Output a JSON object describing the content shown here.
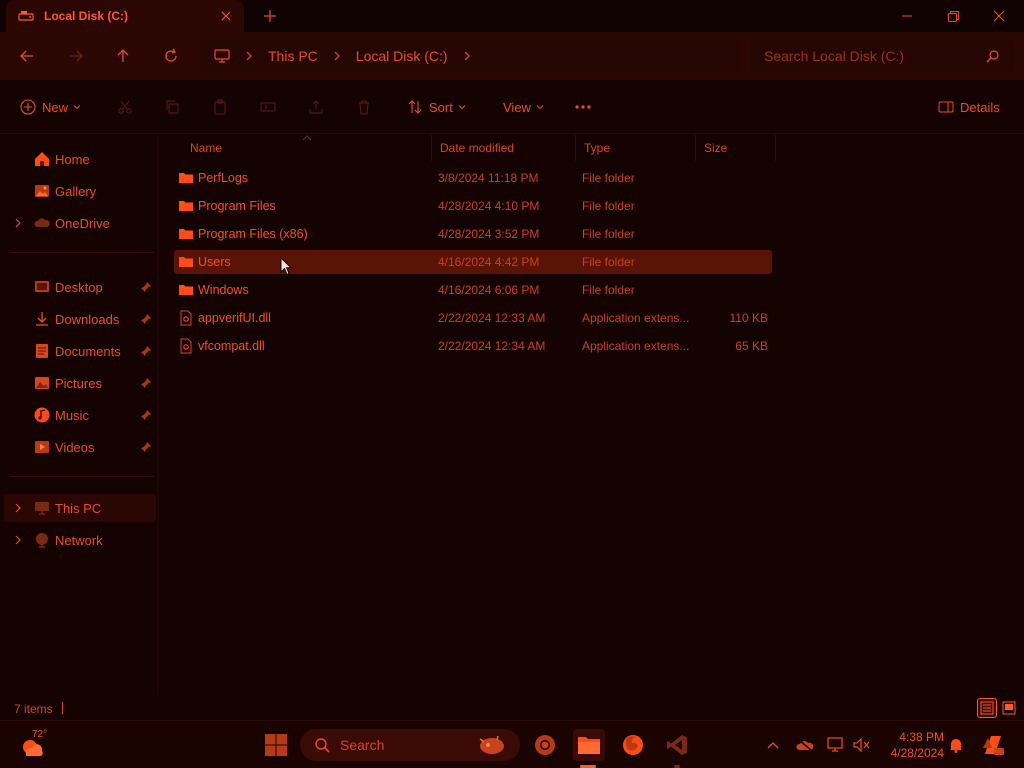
{
  "colors": {
    "accent": "#ff5a24",
    "folder": "#ff4b14",
    "background": "#140300",
    "selection": "#5a1405"
  },
  "window": {
    "tab_title": "Local Disk (C:)",
    "tab_icon": "drive-icon"
  },
  "address": {
    "breadcrumbs": [
      "This PC",
      "Local Disk (C:)"
    ],
    "search_placeholder": "Search Local Disk (C:)"
  },
  "toolbar": {
    "new_label": "New",
    "sort_label": "Sort",
    "view_label": "View",
    "details_label": "Details"
  },
  "sidebar": {
    "items": [
      {
        "label": "Home",
        "icon": "home-icon"
      },
      {
        "label": "Gallery",
        "icon": "gallery-icon"
      },
      {
        "label": "OneDrive",
        "icon": "cloud-icon"
      },
      {
        "label": "Desktop",
        "icon": "desktop-folder-icon",
        "pinned": true
      },
      {
        "label": "Downloads",
        "icon": "download-icon",
        "pinned": true
      },
      {
        "label": "Documents",
        "icon": "documents-icon",
        "pinned": true
      },
      {
        "label": "Pictures",
        "icon": "pictures-icon",
        "pinned": true
      },
      {
        "label": "Music",
        "icon": "music-icon",
        "pinned": true
      },
      {
        "label": "Videos",
        "icon": "videos-icon",
        "pinned": true
      },
      {
        "label": "This PC",
        "icon": "computer-icon"
      },
      {
        "label": "Network",
        "icon": "network-icon"
      }
    ]
  },
  "table": {
    "columns": [
      "Name",
      "Date modified",
      "Type",
      "Size"
    ],
    "rows": [
      {
        "name": "PerfLogs",
        "date": "3/8/2024 11:18 PM",
        "type": "File folder",
        "size": "",
        "icon": "folder-icon"
      },
      {
        "name": "Program Files",
        "date": "4/28/2024 4:10 PM",
        "type": "File folder",
        "size": "",
        "icon": "folder-icon"
      },
      {
        "name": "Program Files (x86)",
        "date": "4/28/2024 3:52 PM",
        "type": "File folder",
        "size": "",
        "icon": "folder-icon"
      },
      {
        "name": "Users",
        "date": "4/16/2024 4:42 PM",
        "type": "File folder",
        "size": "",
        "icon": "folder-icon",
        "selected": true
      },
      {
        "name": "Windows",
        "date": "4/16/2024 6:06 PM",
        "type": "File folder",
        "size": "",
        "icon": "folder-icon"
      },
      {
        "name": "appverifUI.dll",
        "date": "2/22/2024 12:33 AM",
        "type": "Application extens...",
        "size": "110 KB",
        "icon": "dll-file-icon"
      },
      {
        "name": "vfcompat.dll",
        "date": "2/22/2024 12:34 AM",
        "type": "Application extens...",
        "size": "65 KB",
        "icon": "dll-file-icon"
      }
    ]
  },
  "status": {
    "item_count": "7 items"
  },
  "taskbar": {
    "weather_temp": "72°",
    "search_label": "Search",
    "time": "4:38 PM",
    "date": "4/28/2024"
  }
}
